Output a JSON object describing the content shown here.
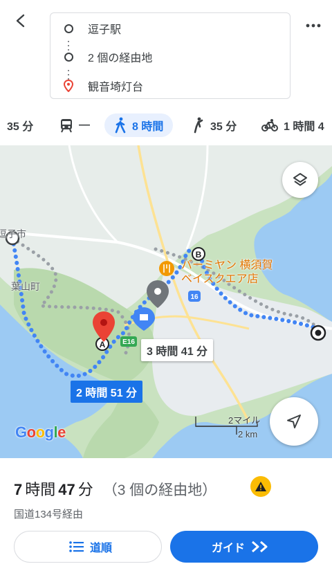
{
  "route": {
    "origin": "逗子駅",
    "waypoints": "2 個の経由地",
    "destination": "観音埼灯台"
  },
  "modes": [
    {
      "icon": "car-icon",
      "label": "35 分"
    },
    {
      "icon": "transit-icon",
      "label": "—"
    },
    {
      "icon": "walk-icon",
      "label": "8 時間",
      "active": true
    },
    {
      "icon": "rideshare-icon",
      "label": "35 分"
    },
    {
      "icon": "bicycle-icon",
      "label": "1 時間 4"
    }
  ],
  "map": {
    "labels": {
      "zushi": "逗子市",
      "hayama": "葉山町",
      "poi": "バーミヤン 横須賀\nベイスクエア店",
      "road16": "16",
      "roadE16": "E16",
      "waypoint_a": "A",
      "waypoint_b": "B"
    },
    "time_primary": "2 時間 51 分",
    "time_alt": "3 時間 41 分",
    "scale_mi": "2マイル",
    "scale_km": "2 km",
    "google": "Google"
  },
  "summary": {
    "hours": "7",
    "hours_unit": "時間",
    "minutes": "47",
    "minutes_unit": "分",
    "waypoints_note": "（3 個の経由地）",
    "via": "国道134号経由"
  },
  "buttons": {
    "steps": "道順",
    "guide": "ガイド"
  },
  "colors": {
    "accent": "#1a73e8",
    "water": "#9ccaf3",
    "land": "#c9e2c0",
    "urban": "#eceff1",
    "warning": "#fbbc04",
    "pin": "#ea4335",
    "poi": "#f29900"
  }
}
